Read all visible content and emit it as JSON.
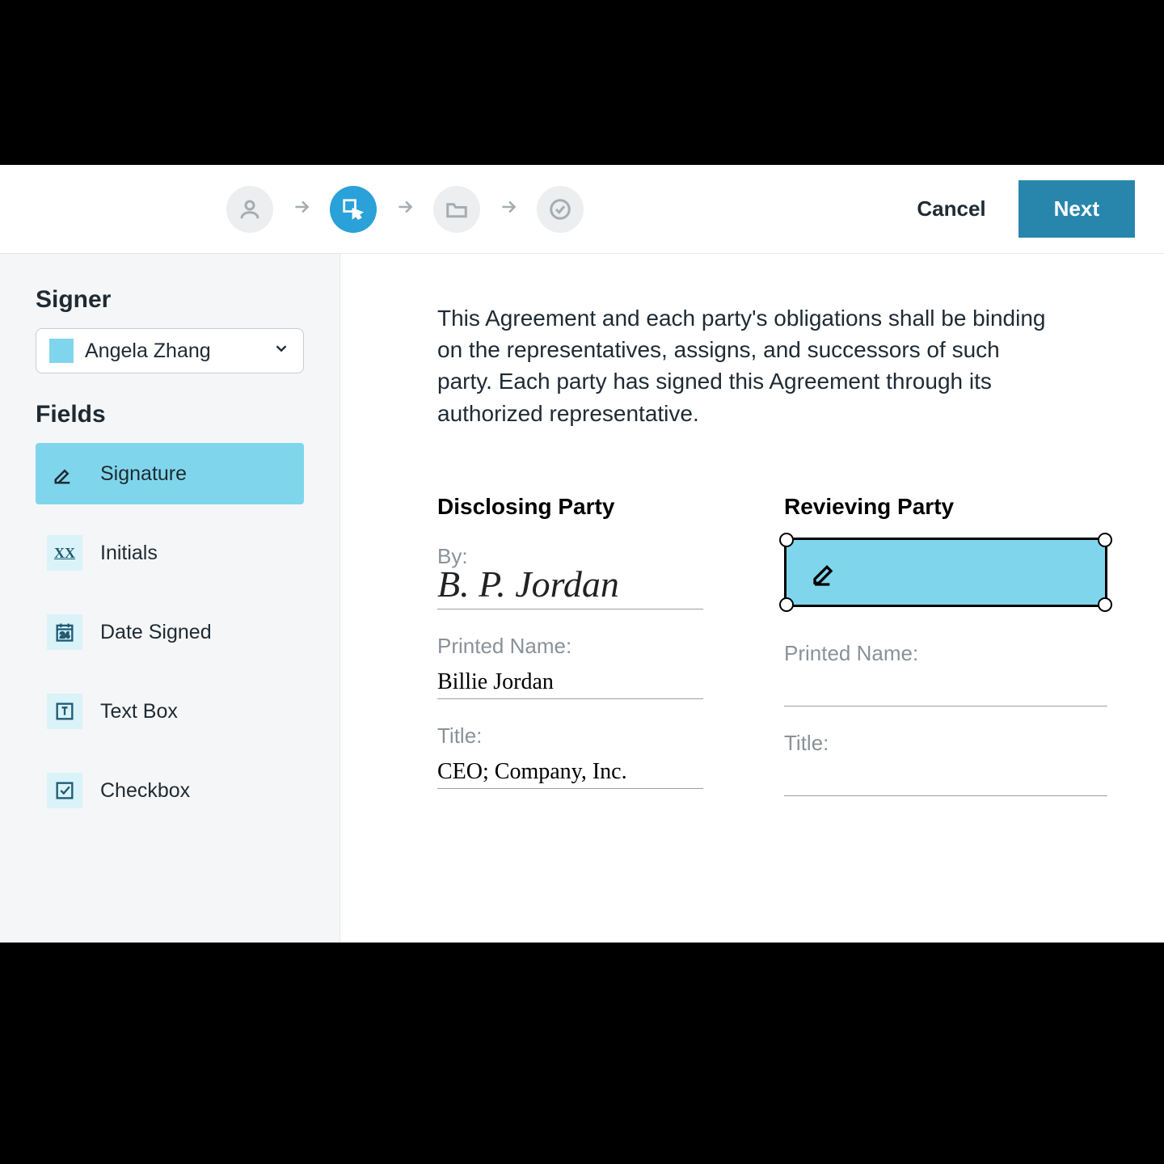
{
  "topbar": {
    "cancel": "Cancel",
    "next": "Next"
  },
  "sidebar": {
    "signer_heading": "Signer",
    "selected_signer": "Angela Zhang",
    "fields_heading": "Fields",
    "fields": [
      {
        "label": "Signature"
      },
      {
        "label": "Initials"
      },
      {
        "label": "Date Signed"
      },
      {
        "label": "Text Box"
      },
      {
        "label": "Checkbox"
      }
    ]
  },
  "document": {
    "paragraph": "This Agreement and each party's obligations shall be binding on the representatives, assigns, and successors of such party. Each party has signed this Agreement through its authorized representative.",
    "disclosing": {
      "heading": "Disclosing Party",
      "by_label": "By:",
      "signature_name": "B. P. Jordan",
      "printed_label": "Printed Name:",
      "printed_value": "Billie Jordan",
      "title_label": "Title:",
      "title_value": "CEO; Company, Inc."
    },
    "receiving": {
      "heading": "Revieving Party",
      "printed_label": "Printed Name:",
      "title_label": "Title:"
    }
  }
}
